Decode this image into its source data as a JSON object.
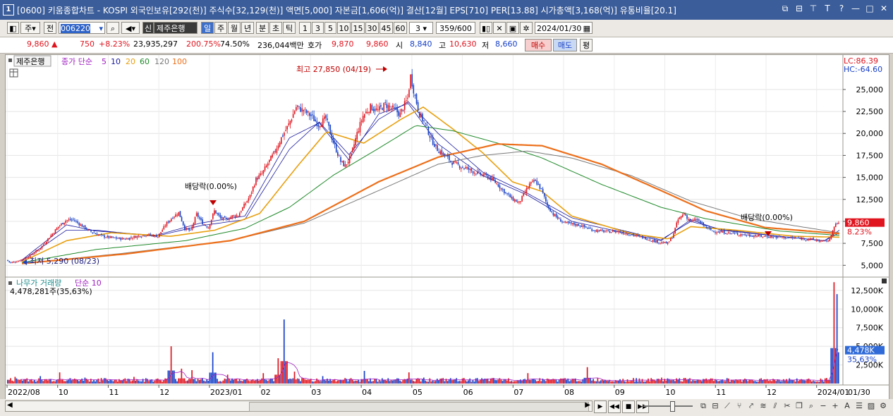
{
  "window": {
    "badge": "1",
    "title": "[0600] 키움종합차트 - KOSPI 외국인보유[292(천)] 주식수[32,129(천)] 액면[5,000] 자본금[1,606(억)] 결산[12월] EPS[710] PER[13.88] 시가총액[3,168(억)] 유통비율[20.1]",
    "controls": [
      "⧉",
      "⊟",
      "⊤",
      "T",
      "?",
      "—",
      "□",
      "✕"
    ]
  },
  "toolbar": {
    "market": "주",
    "prev": "전",
    "code": "006220",
    "sin": "신",
    "stock_name": "제주은행",
    "periods": [
      "일",
      "주",
      "월",
      "년",
      "분",
      "초",
      "틱"
    ],
    "active_period": "일",
    "intervals": [
      "1",
      "3",
      "5",
      "10",
      "15",
      "30",
      "45",
      "60"
    ],
    "interval_value": "3",
    "count": "359",
    "count_total": "/600",
    "date": "2024/01/30"
  },
  "quote": {
    "price": "9,860",
    "direction": "▲",
    "change": "750",
    "change_pct": "+8.23%",
    "volume": "23,935,297",
    "vol_ratio": "200.75%",
    "turnover": "74.50%",
    "amount": "236,044백만",
    "hoga_label": "호가",
    "ask": "9,870",
    "bid": "9,860",
    "open_label": "시",
    "open": "8,840",
    "high_label": "고",
    "high": "10,630",
    "low_label": "저",
    "low": "8,660",
    "buy": "매수",
    "sell": "매도",
    "avg": "평"
  },
  "colors": {
    "up": "#e0141e",
    "down": "#1640c8",
    "ma5": "#1a1aa0",
    "ma10": "#1a1aa0",
    "ma20": "#e8a010",
    "ma60": "#1f8a2a",
    "ma120": "#7a7a7a",
    "ma100": "#ec6f1a",
    "vol_ma": "#a020c0"
  },
  "chart_data": [
    {
      "type": "candlestick",
      "legend_stock": "제주은행",
      "legend_ma": {
        "label": "종가 단순",
        "periods": [
          "5",
          "10",
          "20",
          "60",
          "120",
          "100"
        ]
      },
      "lc": "LC:86.39",
      "hc": "HC:-64.60",
      "y_ticks": [
        "5,000",
        "7,500",
        "10,000",
        "12,500",
        "15,000",
        "17,500",
        "20,000",
        "22,500",
        "25,000"
      ],
      "ylim": [
        3900,
        28600
      ],
      "x_ticks": [
        "2022/08",
        "10",
        "11",
        "12",
        "2023/01",
        "02",
        "03",
        "04",
        "05",
        "06",
        "07",
        "08",
        "09",
        "10",
        "11",
        "12",
        "2024/01"
      ],
      "x_right_label": "01/30",
      "price_marker": {
        "value": 9860,
        "label": "9,860",
        "pct": "8.23%"
      },
      "annotations": {
        "high": "최고 27,850 (04/19)",
        "low": "최저 5,290 (08/23)",
        "ex_div_1": "배당락(0.00%)",
        "ex_div_2": "배당락(0.00%)"
      },
      "series_path": [
        [
          0,
          5600
        ],
        [
          3,
          5300
        ],
        [
          8,
          5500
        ],
        [
          15,
          6000
        ],
        [
          22,
          6800
        ],
        [
          28,
          8000
        ],
        [
          35,
          9400
        ],
        [
          40,
          10100
        ],
        [
          45,
          10200
        ],
        [
          50,
          9600
        ],
        [
          55,
          9000
        ],
        [
          60,
          8600
        ],
        [
          65,
          8300
        ],
        [
          72,
          8100
        ],
        [
          80,
          8000
        ],
        [
          88,
          8300
        ],
        [
          95,
          8500
        ],
        [
          102,
          8300
        ],
        [
          108,
          9800
        ],
        [
          112,
          10500
        ],
        [
          116,
          11000
        ],
        [
          120,
          9200
        ],
        [
          124,
          8900
        ],
        [
          128,
          10800
        ],
        [
          132,
          9800
        ],
        [
          136,
          9300
        ],
        [
          140,
          11200
        ],
        [
          144,
          10400
        ],
        [
          148,
          10200
        ],
        [
          152,
          10600
        ],
        [
          156,
          10700
        ],
        [
          160,
          11800
        ],
        [
          164,
          12900
        ],
        [
          168,
          14800
        ],
        [
          172,
          15400
        ],
        [
          176,
          16600
        ],
        [
          180,
          17700
        ],
        [
          185,
          19500
        ],
        [
          190,
          21000
        ],
        [
          195,
          23000
        ],
        [
          200,
          22600
        ],
        [
          205,
          22000
        ],
        [
          210,
          21000
        ],
        [
          215,
          21700
        ],
        [
          220,
          19000
        ],
        [
          225,
          16800
        ],
        [
          228,
          16300
        ],
        [
          232,
          17500
        ],
        [
          236,
          20000
        ],
        [
          240,
          22000
        ],
        [
          245,
          23000
        ],
        [
          250,
          22600
        ],
        [
          255,
          23300
        ],
        [
          260,
          22800
        ],
        [
          265,
          22200
        ],
        [
          270,
          24000
        ],
        [
          272,
          26500
        ],
        [
          275,
          24200
        ],
        [
          278,
          22200
        ],
        [
          282,
          21000
        ],
        [
          286,
          19300
        ],
        [
          290,
          18200
        ],
        [
          295,
          17500
        ],
        [
          300,
          16700
        ],
        [
          305,
          16300
        ],
        [
          310,
          16000
        ],
        [
          315,
          15600
        ],
        [
          320,
          15300
        ],
        [
          325,
          15000
        ],
        [
          330,
          14300
        ],
        [
          335,
          13400
        ],
        [
          340,
          12600
        ],
        [
          345,
          12100
        ],
        [
          348,
          13000
        ],
        [
          352,
          14200
        ],
        [
          356,
          14600
        ],
        [
          360,
          13600
        ],
        [
          364,
          11800
        ],
        [
          368,
          10800
        ],
        [
          372,
          10200
        ],
        [
          376,
          9800
        ],
        [
          380,
          9700
        ],
        [
          385,
          9600
        ],
        [
          390,
          9300
        ],
        [
          395,
          9000
        ],
        [
          400,
          8900
        ],
        [
          405,
          8800
        ],
        [
          410,
          8900
        ],
        [
          415,
          8700
        ],
        [
          420,
          8500
        ],
        [
          425,
          8300
        ],
        [
          430,
          8100
        ],
        [
          435,
          7800
        ],
        [
          440,
          7600
        ],
        [
          445,
          7500
        ],
        [
          448,
          8200
        ],
        [
          452,
          10200
        ],
        [
          456,
          10900
        ],
        [
          460,
          10000
        ],
        [
          465,
          10200
        ],
        [
          470,
          9400
        ],
        [
          475,
          8900
        ],
        [
          480,
          8800
        ],
        [
          490,
          8600
        ],
        [
          500,
          8400
        ],
        [
          510,
          8300
        ],
        [
          520,
          8200
        ],
        [
          530,
          8100
        ],
        [
          540,
          8000
        ],
        [
          550,
          7700
        ],
        [
          554,
          7900
        ],
        [
          556,
          9100
        ],
        [
          558,
          9600
        ],
        [
          560,
          9860
        ]
      ],
      "ma_series": [
        {
          "key": "ma5",
          "name": "5",
          "points": [
            [
              10,
              5600
            ],
            [
              40,
              9600
            ],
            [
              60,
              8900
            ],
            [
              100,
              8400
            ],
            [
              130,
              9800
            ],
            [
              160,
              10600
            ],
            [
              190,
              19500
            ],
            [
              210,
              21200
            ],
            [
              230,
              17000
            ],
            [
              250,
              22200
            ],
            [
              270,
              23400
            ],
            [
              290,
              18800
            ],
            [
              320,
              15200
            ],
            [
              350,
              13000
            ],
            [
              380,
              10000
            ],
            [
              440,
              7800
            ],
            [
              460,
              10200
            ],
            [
              480,
              9000
            ],
            [
              520,
              8300
            ],
            [
              550,
              7800
            ],
            [
              560,
              9000
            ]
          ]
        },
        {
          "key": "ma10",
          "name": "10",
          "points": [
            [
              10,
              5500
            ],
            [
              40,
              9000
            ],
            [
              60,
              9000
            ],
            [
              100,
              8300
            ],
            [
              130,
              9500
            ],
            [
              160,
              10200
            ],
            [
              190,
              18200
            ],
            [
              210,
              21300
            ],
            [
              230,
              17600
            ],
            [
              250,
              21600
            ],
            [
              270,
              23600
            ],
            [
              290,
              20000
            ],
            [
              320,
              15600
            ],
            [
              350,
              13200
            ],
            [
              380,
              10400
            ],
            [
              440,
              7900
            ],
            [
              460,
              10000
            ],
            [
              480,
              9100
            ],
            [
              520,
              8300
            ],
            [
              550,
              7800
            ],
            [
              560,
              8700
            ]
          ]
        },
        {
          "key": "ma20",
          "name": "20",
          "points": [
            [
              10,
              5400
            ],
            [
              40,
              7800
            ],
            [
              70,
              8700
            ],
            [
              110,
              8300
            ],
            [
              140,
              9000
            ],
            [
              170,
              10900
            ],
            [
              195,
              16200
            ],
            [
              215,
              20200
            ],
            [
              240,
              18900
            ],
            [
              265,
              21600
            ],
            [
              280,
              23000
            ],
            [
              300,
              20500
            ],
            [
              320,
              17800
            ],
            [
              340,
              14500
            ],
            [
              360,
              13400
            ],
            [
              380,
              10600
            ],
            [
              420,
              8600
            ],
            [
              445,
              8000
            ],
            [
              460,
              9400
            ],
            [
              490,
              9000
            ],
            [
              530,
              8300
            ],
            [
              560,
              8200
            ]
          ]
        },
        {
          "key": "ma60",
          "name": "60",
          "points": [
            [
              10,
              5300
            ],
            [
              60,
              6800
            ],
            [
              120,
              7800
            ],
            [
              160,
              9200
            ],
            [
              190,
              11600
            ],
            [
              220,
              15300
            ],
            [
              250,
              18300
            ],
            [
              275,
              20900
            ],
            [
              300,
              20300
            ],
            [
              330,
              18900
            ],
            [
              360,
              17200
            ],
            [
              400,
              14200
            ],
            [
              440,
              11600
            ],
            [
              470,
              10300
            ],
            [
              520,
              8900
            ],
            [
              560,
              8400
            ]
          ]
        },
        {
          "key": "ma120",
          "name": "120",
          "points": [
            [
              10,
              5200
            ],
            [
              80,
              6400
            ],
            [
              150,
              7800
            ],
            [
              200,
              9800
            ],
            [
              250,
              13500
            ],
            [
              290,
              16500
            ],
            [
              320,
              17500
            ],
            [
              350,
              18000
            ],
            [
              380,
              17200
            ],
            [
              420,
              15200
            ],
            [
              460,
              12300
            ],
            [
              500,
              10300
            ],
            [
              560,
              8700
            ]
          ]
        },
        {
          "key": "ma100",
          "name": "100",
          "points": [
            [
              10,
              5200
            ],
            [
              80,
              6300
            ],
            [
              150,
              7800
            ],
            [
              200,
              10000
            ],
            [
              250,
              14500
            ],
            [
              290,
              17300
            ],
            [
              330,
              18800
            ],
            [
              360,
              18600
            ],
            [
              400,
              16500
            ],
            [
              440,
              13500
            ],
            [
              470,
              11200
            ],
            [
              510,
              9300
            ],
            [
              560,
              8600
            ]
          ]
        }
      ]
    },
    {
      "type": "bar",
      "legend": {
        "label": "나무가 거래량",
        "ma": "단순 10"
      },
      "current": "4,478,281주(35,63%)",
      "y_ticks": [
        "2,500K",
        "5,000K",
        "7,500K",
        "10,000K",
        "12,500K"
      ],
      "ylim": [
        0,
        14000
      ],
      "marker": {
        "value": 4478,
        "label": "4,478K",
        "pct": "35,63%"
      },
      "spikes": [
        [
          5,
          900
        ],
        [
          13,
          700
        ],
        [
          22,
          1000
        ],
        [
          35,
          1500
        ],
        [
          52,
          800
        ],
        [
          85,
          900
        ],
        [
          110,
          5000
        ],
        [
          117,
          2000
        ],
        [
          124,
          1800
        ],
        [
          138,
          4200
        ],
        [
          148,
          1200
        ],
        [
          172,
          1400
        ],
        [
          182,
          3400
        ],
        [
          186,
          8600
        ],
        [
          193,
          1600
        ],
        [
          212,
          1000
        ],
        [
          240,
          1700
        ],
        [
          270,
          1500
        ],
        [
          280,
          800
        ],
        [
          315,
          700
        ],
        [
          350,
          1400
        ],
        [
          390,
          2200
        ],
        [
          440,
          800
        ],
        [
          450,
          700
        ],
        [
          500,
          500
        ],
        [
          540,
          500
        ],
        [
          556,
          13600
        ],
        [
          558,
          12000
        ],
        [
          560,
          4478
        ]
      ]
    }
  ]
}
